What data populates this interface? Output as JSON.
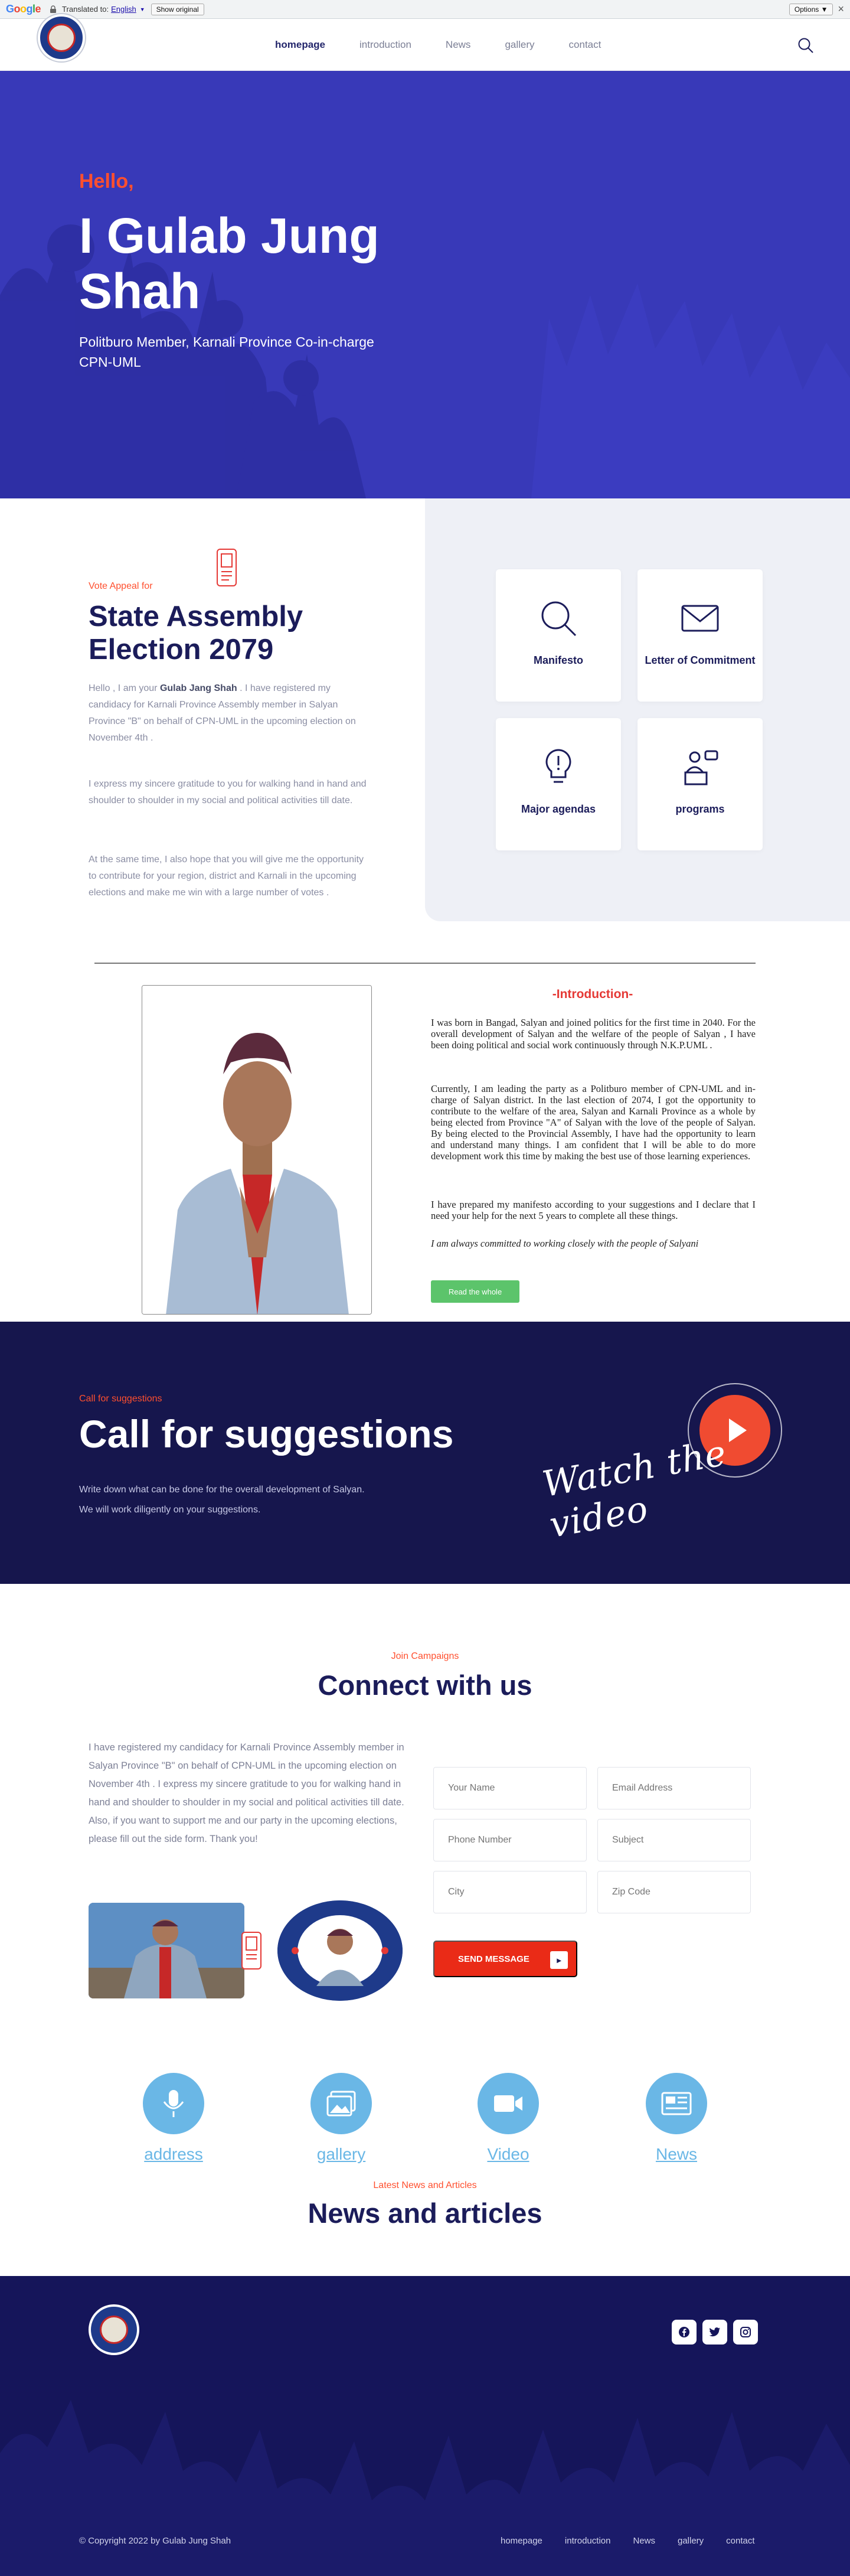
{
  "translate_bar": {
    "logo": "Google",
    "translated_to_label": "Translated to:",
    "language": "English",
    "show_original": "Show original",
    "options": "Options ▼",
    "close": "×"
  },
  "nav": {
    "items": [
      "homepage",
      "introduction",
      "News",
      "gallery",
      "contact"
    ],
    "active": "homepage"
  },
  "hero": {
    "hello": "Hello,",
    "name": "I Gulab Jung Shah",
    "subtitle": "Politburo Member, Karnali Province Co-in-charge CPN-UML"
  },
  "appeal": {
    "kicker": "Vote Appeal for",
    "title": "State Assembly Election 2079",
    "p1_pre": "Hello , I am your ",
    "p1_name": "Gulab Jang Shah",
    "p1_post": " . I have registered my candidacy for Karnali Province Assembly member in Salyan Province \"B\" on behalf of CPN-UML in the upcoming election on November 4th .",
    "p2": "I express my sincere gratitude to you for walking hand in hand and shoulder to shoulder in my social and political activities till date.",
    "p3": "At the same time, I also hope that you will give me the opportunity to contribute for your region, district and Karnali in the upcoming elections and make me win with a large number of votes ."
  },
  "cards": [
    {
      "label": "Manifesto",
      "icon": "search-icon"
    },
    {
      "label": "Letter of Commitment",
      "icon": "envelope-icon"
    },
    {
      "label": "Major agendas",
      "icon": "lightbulb-icon"
    },
    {
      "label": "programs",
      "icon": "speaker-icon"
    }
  ],
  "intro": {
    "heading": "-Introduction-",
    "p1": "I was born in Bangad, Salyan and joined politics for the first time in 2040. For the overall development of Salyan and the welfare of the people of Salyan , I have been doing political and social work continuously through N.K.P.UML .",
    "p2": "Currently, I am leading the party as a Politburo member of CPN-UML and in-charge of Salyan district. In the last election of 2074, I got the opportunity to contribute to the welfare of the area, Salyan and Karnali Province as a whole by being elected from Province \"A\" of Salyan with the love of the people of Salyan. By being elected to the Provincial Assembly, I have had the opportunity to learn and understand many things. I am confident that I will be able to do more development work this time by making the best use of those learning experiences.",
    "p3": "I have prepared my manifesto according to your suggestions and I declare that I need your help for the next 5 years to complete all these things.",
    "p4": "I am always committed to working closely with the people of Salyani",
    "button": "Read the whole"
  },
  "suggestions": {
    "kicker": "Call for suggestions",
    "title": "Call for suggestions",
    "line1": "Write down what can be done for the overall development of Salyan.",
    "line2": "We will work diligently on your suggestions.",
    "watch": "Watch the video"
  },
  "connect": {
    "kicker": "Join Campaigns",
    "title": "Connect with us",
    "paragraph": "I have registered my candidacy for Karnali Province Assembly member in Salyan Province \"B\" on behalf of CPN-UML in the upcoming election on November 4th . I express my sincere gratitude to you for walking hand in hand and shoulder to shoulder in my social and political activities till date. Also, if you want to support me and our party in the upcoming elections, please fill out the side form. Thank you!",
    "fields": {
      "name": "Your Name",
      "email": "Email Address",
      "phone": "Phone Number",
      "subject": "Subject",
      "city": "City",
      "zip": "Zip Code"
    },
    "send": "SEND MESSAGE"
  },
  "quick_links": [
    {
      "label": "address",
      "icon": "microphone-icon"
    },
    {
      "label": "gallery",
      "icon": "image-icon"
    },
    {
      "label": "Video",
      "icon": "video-camera-icon"
    },
    {
      "label": "News",
      "icon": "newspaper-icon"
    }
  ],
  "news": {
    "kicker": "Latest News and Articles",
    "title": "News and articles"
  },
  "footer": {
    "copyright": "© Copyright 2022 by Gulab Jung Shah",
    "links": [
      "homepage",
      "introduction",
      "News",
      "gallery",
      "contact"
    ],
    "social": [
      "facebook-icon",
      "twitter-icon",
      "instagram-icon"
    ]
  },
  "colors": {
    "hero_bg": "#3839b8",
    "navy": "#1b1c5a",
    "accent_red": "#ff4f2e",
    "button_green": "#5cc46b",
    "quick_link_blue": "#6ab7e6",
    "footer_bg": "#15155a"
  }
}
